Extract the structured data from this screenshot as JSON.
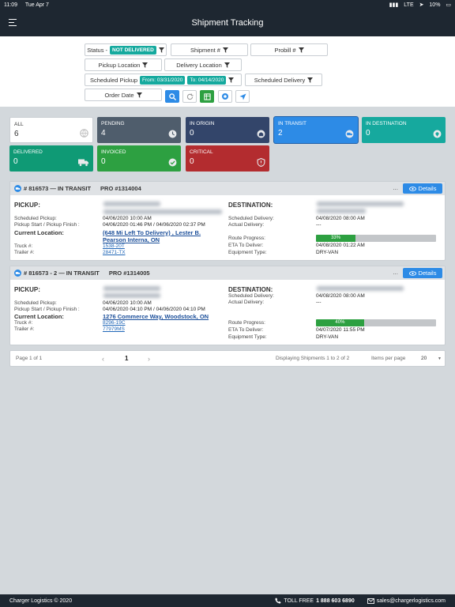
{
  "status_bar": {
    "time": "11:09",
    "date": "Tue Apr 7",
    "network": "LTE",
    "battery": "10%"
  },
  "header": {
    "title": "Shipment Tracking"
  },
  "filters": {
    "status_label": "Status -",
    "status_value": "NOT DELIVERED",
    "shipment_label": "Shipment #",
    "probill_label": "Probill #",
    "pickup_location_label": "Pickup Location",
    "delivery_location_label": "Delivery Location",
    "scheduled_pickup_label": "Scheduled Pickup",
    "from_date": "From: 03/31/2020",
    "to_date": "To: 04/14/2020",
    "scheduled_delivery_label": "Scheduled Delivery",
    "order_date_label": "Order Date"
  },
  "colors": {
    "all": "#ffffff",
    "pending": "#4f5d6c",
    "in_origin": "#33456a",
    "in_transit": "#2d8be6",
    "in_destination": "#16a99e",
    "delivered": "#0f9a75",
    "invoiced": "#2da041",
    "critical": "#b32c2f"
  },
  "tiles": [
    {
      "label": "ALL",
      "count": "6",
      "icon": "globe-icon"
    },
    {
      "label": "PENDING",
      "count": "4",
      "icon": "clock-icon"
    },
    {
      "label": "IN ORIGIN",
      "count": "0",
      "icon": "warehouse-icon"
    },
    {
      "label": "IN TRANSIT",
      "count": "2",
      "icon": "truck-icon"
    },
    {
      "label": "IN DESTINATION",
      "count": "0",
      "icon": "location-pin-icon"
    },
    {
      "label": "DELIVERED",
      "count": "0",
      "icon": "delivery-truck-icon"
    },
    {
      "label": "INVOICED",
      "count": "0",
      "icon": "check-circle-icon"
    },
    {
      "label": "CRITICAL",
      "count": "0",
      "icon": "shield-alert-icon"
    }
  ],
  "labels": {
    "pickup": "PICKUP:",
    "destination": "DESTINATION:",
    "scheduled_pickup": "Scheduled Pickup:",
    "pickup_start_finish": "Pickup Start / Pickup Finish :",
    "current_location": "Current Location:",
    "truck": "Truck #:",
    "trailer": "Trailer #:",
    "scheduled_delivery": "Scheduled Delivery:",
    "actual_delivery": "Actual Delivery:",
    "route_progress": "Route Progress:",
    "eta": "ETA To Deliver:",
    "equipment_type": "Equipment Type:",
    "details_button": "Details",
    "more": "..."
  },
  "shipments": [
    {
      "title": "# 816573 — IN TRANSIT",
      "pro": "PRO #1314004",
      "scheduled_pickup": "04/06/2020 10:00 AM",
      "pickup_start_finish": "04/06/2020 01:46 PM  /  04/06/2020 02:37 PM",
      "current_location_line1": "(648 Mi Left To Delivery) , Lester B.",
      "current_location_line2": "Pearson Interna, ON",
      "truck": "1538-20T",
      "trailer": "28471-TX",
      "scheduled_delivery": "04/08/2020 08:00 AM",
      "actual_delivery": "---",
      "route_progress": 33,
      "route_progress_text": "33%",
      "eta": "04/08/2020 01:22 AM",
      "equipment_type": "DRY-VAN"
    },
    {
      "title": "# 816573 - 2 — IN TRANSIT",
      "pro": "PRO #1314005",
      "scheduled_pickup": "04/06/2020 10:00 AM",
      "pickup_start_finish": "04/06/2020 04:10 PM  /  04/06/2020 04:10 PM",
      "current_location_line1": "1276 Commerce Way, Woodstock, ON",
      "current_location_line2": "",
      "truck": "8296-19C",
      "trailer": "77979MS",
      "scheduled_delivery": "04/08/2020 08:00 AM",
      "actual_delivery": "---",
      "route_progress": 40,
      "route_progress_text": "40%",
      "eta": "04/07/2020 11:55 PM",
      "equipment_type": "DRY-VAN"
    }
  ],
  "pagination": {
    "page_info": "Page 1 of 1",
    "prev": "‹",
    "current": "1",
    "next": "›",
    "display_info": "Displaying Shipments 1 to 2 of 2",
    "items_per_page_label": "Items per page",
    "items_per_page": "20"
  },
  "footer": {
    "copyright": "Charger Logistics © 2020",
    "toll_free_label": "TOLL FREE",
    "phone": "1 888 603 6890",
    "email": "sales@chargerlogistics.com"
  }
}
